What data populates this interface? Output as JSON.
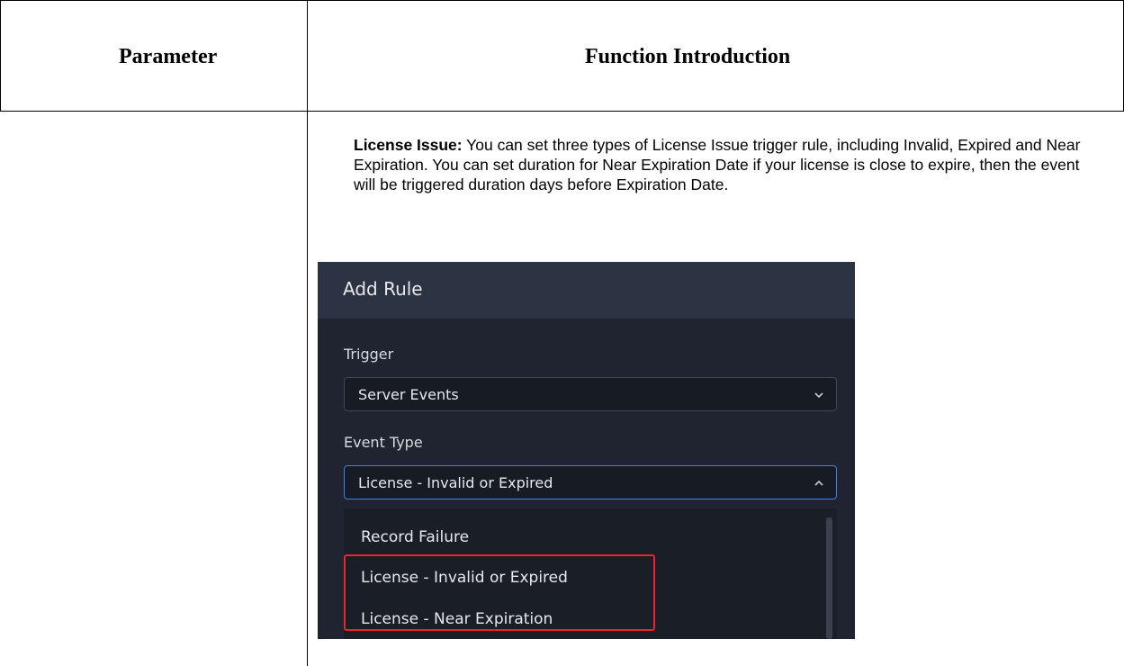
{
  "table": {
    "headers": {
      "parameter": "Parameter",
      "function": "Function Introduction"
    }
  },
  "row": {
    "parameter": "",
    "description": {
      "term": "License Issue:",
      "text": " You can set three types of License Issue trigger rule, including Invalid, Expired and Near Expiration. You can set duration for Near Expiration Date if your license is close to expire, then the event will be triggered duration days before Expiration Date."
    }
  },
  "dialog": {
    "title": "Add Rule",
    "trigger": {
      "label": "Trigger",
      "value": "Server Events",
      "icon": "chevron-down-icon"
    },
    "event_type": {
      "label": "Event Type",
      "value": "License - Invalid or Expired",
      "icon": "chevron-up-icon"
    },
    "options": [
      "Record Failure",
      "License - Invalid or Expired",
      "License - Near Expiration"
    ],
    "highlight_color": "#e8262b",
    "accent_color": "#3b82f6"
  }
}
